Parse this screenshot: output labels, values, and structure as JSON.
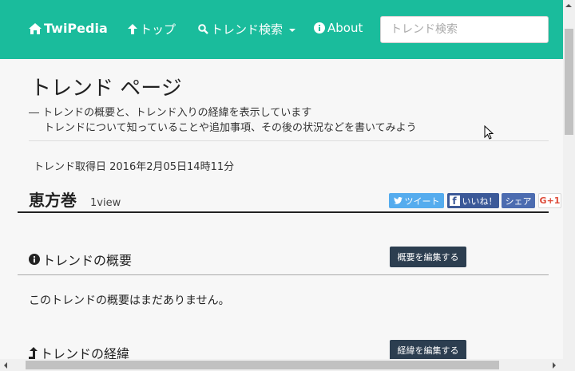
{
  "navbar": {
    "brand": "TwiPedia",
    "top": "トップ",
    "search_menu": "トレンド検索",
    "about": "About",
    "search_placeholder": "トレンド検索"
  },
  "page": {
    "title": "トレンド ページ",
    "desc_line1": "― トレンドの概要と、トレンド入りの経緯を表示しています",
    "desc_line2": "トレンドについて知っていることや追加事項、その後の状況などを書いてみよう",
    "date": "トレンド取得日 2016年2月05日14時11分"
  },
  "trend": {
    "name": "恵方巻",
    "views": "1view"
  },
  "share": {
    "tweet": "ツイート",
    "like": "いいね！",
    "share": "シェア",
    "gplus": "G+1"
  },
  "sections": {
    "summary_title": "トレンドの概要",
    "summary_edit": "概要を編集する",
    "summary_empty": "このトレンドの概要はまだありません。",
    "history_title": "トレンドの経緯",
    "history_edit": "経緯を編集する"
  },
  "colors": {
    "navbar": "#1abc9c",
    "button": "#2c3e50",
    "twitter": "#55acee",
    "facebook": "#3b5998"
  }
}
